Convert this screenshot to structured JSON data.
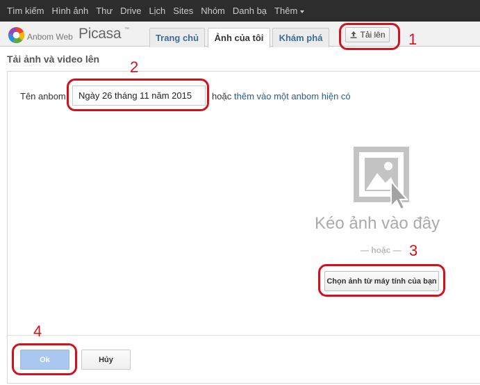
{
  "gbar": {
    "links": [
      "Tìm kiếm",
      "Hình ảnh",
      "Thư",
      "Drive",
      "Lịch",
      "Sites",
      "Nhóm",
      "Danh bạ",
      "Thêm"
    ]
  },
  "header": {
    "logo_small": "Anbom Web",
    "logo_big": "Picasa",
    "logo_tm": "™",
    "tabs": [
      {
        "label": "Trang chủ"
      },
      {
        "label": "Ảnh của tôi"
      },
      {
        "label": "Khám phá"
      }
    ],
    "upload_label": "Tải lên"
  },
  "page": {
    "title": "Tải ảnh và video lên"
  },
  "form": {
    "album_label": "Tên anbom",
    "album_value": "Ngày 26 tháng 11 năm 2015",
    "or_text": "hoặc",
    "album_link": "thêm vào một anbom hiện có",
    "drop_text": "Kéo ảnh vào đây",
    "or_divider": "— hoặc —",
    "choose_label": "Chọn ảnh từ máy tính của bạn",
    "ok_label": "Ok",
    "cancel_label": "Hủy"
  },
  "annotations": [
    "1",
    "2",
    "3",
    "4"
  ],
  "colors": {
    "annotation_red": "#d4111b",
    "ok_blue": "#a9c7ef",
    "link_blue": "#2a5d8a"
  }
}
